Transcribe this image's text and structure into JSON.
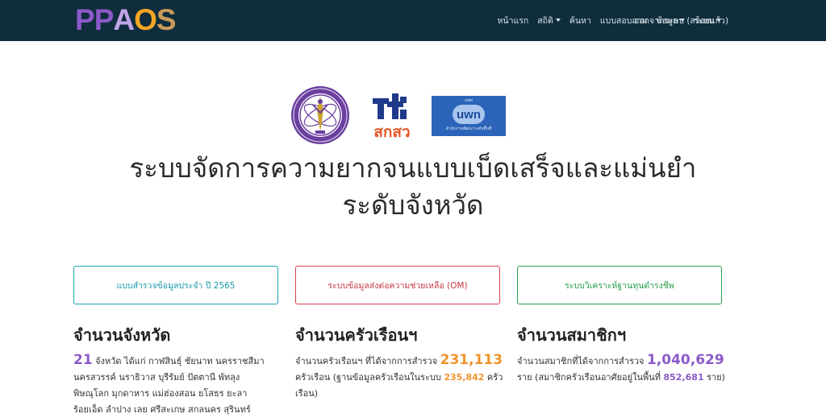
{
  "brand": {
    "name": "PPAOS",
    "letters": [
      "P",
      "P",
      "A",
      "O",
      "S"
    ],
    "colors": [
      "#8b5ac8",
      "#8b5ac8",
      "#c2a5e6",
      "#f5a623",
      "#c89a5a"
    ]
  },
  "nav": {
    "items": [
      {
        "label": "หน้าแรก",
        "dropdown": false
      },
      {
        "label": "สถิติ",
        "dropdown": true
      },
      {
        "label": "ค้นหา",
        "dropdown": false
      },
      {
        "label": "แบบสอบถาม",
        "dropdown": false
      },
      {
        "label": "ข้อมูล",
        "dropdown": true
      },
      {
        "label": "ระบบ",
        "dropdown": true
      }
    ],
    "logout": "ออกจากระบบ (สร้อยแก้ว)"
  },
  "partner_logos": {
    "tsri_text": "สกสว",
    "uwn_text": "uwn",
    "uwn_tagline": "บพท",
    "uwn_caption": "สำนักงานพัฒนาระดับพื้นที่"
  },
  "title_line1": "ระบบจัดการความยากจนแบบเบ็ดเสร็จและแม่นยำ",
  "title_line2": "ระดับจังหวัด",
  "buttons": {
    "survey": "แบบสำรวจข้อมูลประจำ ปี 2565",
    "om": "ระบบข้อมูลส่งต่อความช่วยเหลือ (OM)",
    "livelihood": "ระบบวิเคราะห์ฐานทุนดำรงชีพ"
  },
  "stats": {
    "provinces": {
      "heading": "จำนวนจังหวัด",
      "count": "21",
      "intro": " จังหวัด ได้แก่ ",
      "list_line1": "กาฬสินธุ์ ชัยนาท นครราชสีมา",
      "list_line2": "นครสวรรค์ นราธิวาส บุรีรัมย์ ปัตตานี พัทลุง",
      "list_line3": "พิษณุโลก มุกดาหาร แม่ฮ่องสอน ยโสธร ยะลา",
      "list_line4": "ร้อยเอ็ด ลำปาง เลย ศรีสะเกษ สกลนคร สุรินทร์"
    },
    "households": {
      "heading": "จำนวนครัวเรือนฯ",
      "prefix": "จำนวนครัวเรือนฯ ที่ได้จากการสำรวจ ",
      "count": "231,113",
      "mid": "ครัวเรือน (ฐานข้อมูลครัวเรือนในระบบ ",
      "base": "235,842",
      "suffix": " ครัว",
      "suffix2": "เรือน)"
    },
    "members": {
      "heading": "จำนวนสมาชิกฯ",
      "prefix": "จำนวนสมาชิกที่ได้จากการสำรวจ ",
      "count": "1,040,629",
      "mid": "ราย (สมาชิกครัวเรือนอาศัยอยู่ในพื้นที่ ",
      "resident": "852,681",
      "suffix": " ราย)"
    }
  }
}
